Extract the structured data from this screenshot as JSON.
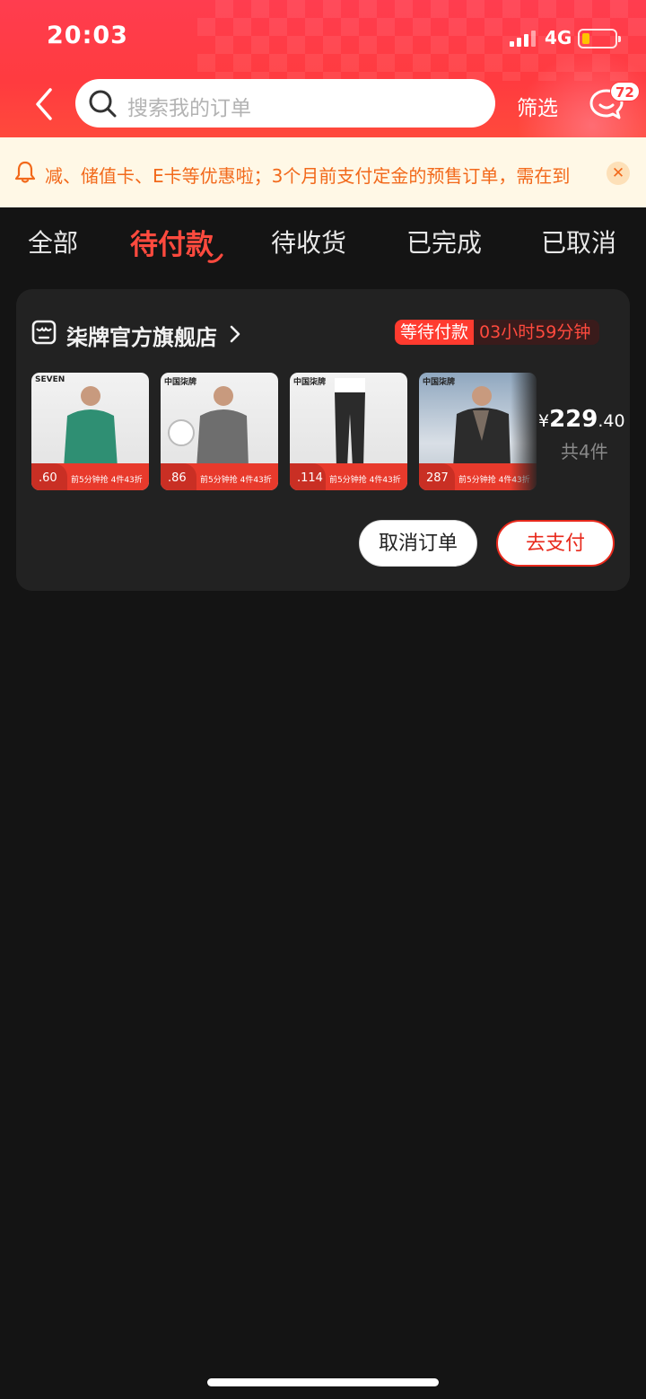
{
  "status_bar": {
    "time": "20:03",
    "network": "4G"
  },
  "header": {
    "search_placeholder": "搜索我的订单",
    "filter_label": "筛选",
    "message_badge": "72"
  },
  "notice": {
    "text": "减、储值卡、E卡等优惠啦；3个月前支付定金的预售订单，需在到"
  },
  "tabs": [
    {
      "label": "全部"
    },
    {
      "label": "待付款"
    },
    {
      "label": "待收货"
    },
    {
      "label": "已完成"
    },
    {
      "label": "已取消"
    }
  ],
  "order": {
    "shop_name": "柒牌官方旗舰店",
    "status_label": "等待付款",
    "countdown": "03小时59分钟",
    "items": [
      {
        "shirt_color": "#2f8f73",
        "price_fragment": ".60",
        "promo": "前5分钟抢 4件43折"
      },
      {
        "shirt_color": "#6e6e6e",
        "price_fragment": ".86",
        "promo": "前5分钟抢 4件43折"
      },
      {
        "shirt_color": "#2b2b2b",
        "price_fragment": ".114",
        "promo": "前5分钟抢 4件43折"
      },
      {
        "shirt_color": "#2c2c2c",
        "price_fragment": "287",
        "promo": "前5分钟抢 4件43折"
      }
    ],
    "total_symbol": "¥",
    "total_integer": "229",
    "total_decimal": ".40",
    "item_count": "共4件",
    "cancel_label": "取消订单",
    "pay_label": "去支付"
  },
  "colors": {
    "accent": "#ff3b3f",
    "pay_red": "#e8291c",
    "notice_orange": "#f2691b"
  }
}
